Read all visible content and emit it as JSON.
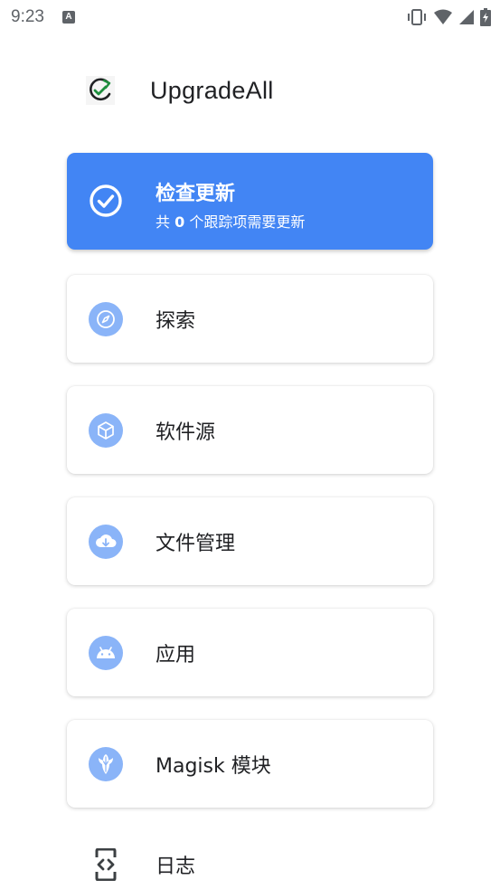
{
  "status_bar": {
    "time": "9:23",
    "notification_letter": "A",
    "icons": [
      "vibrate-icon",
      "wifi-icon",
      "signal-icon",
      "battery-charging-icon"
    ]
  },
  "header": {
    "title": "UpgradeAll",
    "logo_icon": "upgrade-check-logo-icon"
  },
  "menu": {
    "check_update": {
      "label": "检查更新",
      "sub_prefix": "共",
      "count": "0",
      "sub_suffix": "个跟踪项需要更新",
      "icon": "check-circle-icon"
    },
    "items": [
      {
        "label": "探索",
        "icon": "compass-icon"
      },
      {
        "label": "软件源",
        "icon": "cube-icon"
      },
      {
        "label": "文件管理",
        "icon": "cloud-download-icon"
      },
      {
        "label": "应用",
        "icon": "android-icon"
      },
      {
        "label": "Magisk 模块",
        "icon": "magisk-icon"
      }
    ],
    "log": {
      "label": "日志",
      "icon": "code-log-icon"
    }
  },
  "colors": {
    "primary": "#4285f4",
    "icon_bg": "#8ab4f8",
    "text": "#202124"
  }
}
